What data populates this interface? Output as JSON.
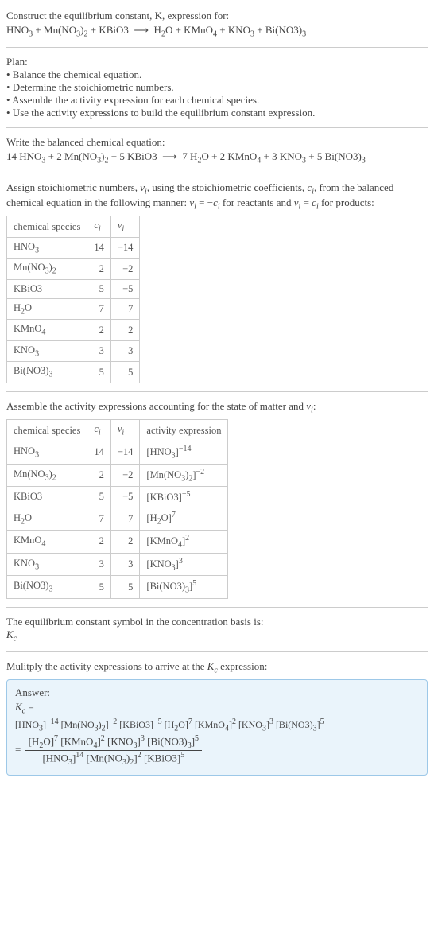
{
  "title": "Construct the equilibrium constant, K, expression for:",
  "eq_unbalanced": "HNO₃ + Mn(NO₃)₂ + KBiO3 ⟶ H₂O + KMnO₄ + KNO₃ + Bi(NO3)₃",
  "plan_header": "Plan:",
  "plan_items": [
    "• Balance the chemical equation.",
    "• Determine the stoichiometric numbers.",
    "• Assemble the activity expression for each chemical species.",
    "• Use the activity expressions to build the equilibrium constant expression."
  ],
  "balanced_header": "Write the balanced chemical equation:",
  "eq_balanced": "14 HNO₃ + 2 Mn(NO₃)₂ + 5 KBiO3 ⟶ 7 H₂O + 2 KMnO₄ + 3 KNO₃ + 5 Bi(NO3)₃",
  "stoich_header1": "Assign stoichiometric numbers, νᵢ, using the stoichiometric coefficients, cᵢ, from the balanced chemical equation in the following manner: νᵢ = −cᵢ for reactants and νᵢ = cᵢ for products:",
  "stoich_table": {
    "headers": [
      "chemical species",
      "cᵢ",
      "νᵢ"
    ],
    "rows": [
      [
        "HNO₃",
        "14",
        "−14"
      ],
      [
        "Mn(NO₃)₂",
        "2",
        "−2"
      ],
      [
        "KBiO3",
        "5",
        "−5"
      ],
      [
        "H₂O",
        "7",
        "7"
      ],
      [
        "KMnO₄",
        "2",
        "2"
      ],
      [
        "KNO₃",
        "3",
        "3"
      ],
      [
        "Bi(NO3)₃",
        "5",
        "5"
      ]
    ]
  },
  "activity_header": "Assemble the activity expressions accounting for the state of matter and νᵢ:",
  "activity_table": {
    "headers": [
      "chemical species",
      "cᵢ",
      "νᵢ",
      "activity expression"
    ],
    "rows": [
      [
        "HNO₃",
        "14",
        "−14",
        "[HNO₃]⁻¹⁴"
      ],
      [
        "Mn(NO₃)₂",
        "2",
        "−2",
        "[Mn(NO₃)₂]⁻²"
      ],
      [
        "KBiO3",
        "5",
        "−5",
        "[KBiO3]⁻⁵"
      ],
      [
        "H₂O",
        "7",
        "7",
        "[H₂O]⁷"
      ],
      [
        "KMnO₄",
        "2",
        "2",
        "[KMnO₄]²"
      ],
      [
        "KNO₃",
        "3",
        "3",
        "[KNO₃]³"
      ],
      [
        "Bi(NO3)₃",
        "5",
        "5",
        "[Bi(NO3)₃]⁵"
      ]
    ]
  },
  "kc_symbol_header": "The equilibrium constant symbol in the concentration basis is:",
  "kc_symbol": "K_c",
  "multiply_header": "Mulitply the activity expressions to arrive at the K_c expression:",
  "answer_label": "Answer:",
  "kc_line1_lhs": "K_c =",
  "kc_line1_rhs": "[HNO₃]⁻¹⁴ [Mn(NO₃)₂]⁻² [KBiO3]⁻⁵ [H₂O]⁷ [KMnO₄]² [KNO₃]³ [Bi(NO3)₃]⁵",
  "kc_line2_eq": "=",
  "kc_frac_top": "[H₂O]⁷ [KMnO₄]² [KNO₃]³ [Bi(NO3)₃]⁵",
  "kc_frac_bot": "[HNO₃]¹⁴ [Mn(NO₃)₂]² [KBiO3]⁵"
}
